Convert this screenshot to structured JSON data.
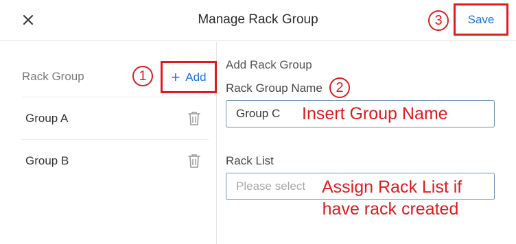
{
  "header": {
    "title": "Manage Rack Group",
    "save_label": "Save"
  },
  "callouts": {
    "one": "1",
    "two": "2",
    "three": "3"
  },
  "left_panel": {
    "heading": "Rack Group",
    "add_label": "Add",
    "groups": [
      {
        "label": "Group A"
      },
      {
        "label": "Group B"
      }
    ]
  },
  "right_panel": {
    "section_title": "Add Rack Group",
    "name_label": "Rack Group Name",
    "name_value": "Group C",
    "rack_list_label": "Rack List",
    "rack_list_placeholder": "Please select"
  },
  "annotations": {
    "insert_name": "Insert Group Name",
    "assign_line1": "Assign Rack List if",
    "assign_line2": "have rack created"
  },
  "colors": {
    "accent": "#1a73e8",
    "annotation_red": "#e01b1b"
  },
  "icons": [
    "close-icon",
    "plus-icon",
    "trash-icon"
  ]
}
